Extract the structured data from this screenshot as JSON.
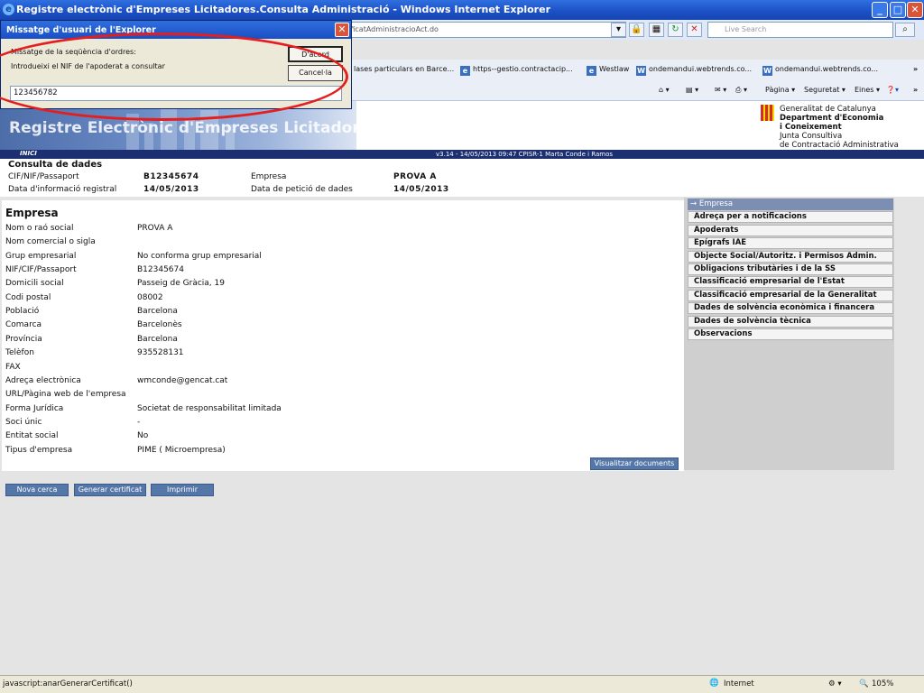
{
  "window": {
    "title": "Registre electrònic d'Empreses Licitadores.Consulta Administració - Windows Internet Explorer",
    "minimize": "_",
    "maximize": "□",
    "close": "✕"
  },
  "toolbar": {
    "address": "tificatAdministracioAct.do",
    "search_placeholder": "Live Search"
  },
  "favorites": [
    {
      "label": "lases particulars en Barce..."
    },
    {
      "label": "https--gestio.contractacip..."
    },
    {
      "label": "Westlaw"
    },
    {
      "label": "ondemandui.webtrends.co..."
    },
    {
      "label": "ondemandui.webtrends.co..."
    }
  ],
  "commands": {
    "page": "Pàgina ▾",
    "security": "Seguretat ▾",
    "tools": "Eines ▾",
    "more": "»"
  },
  "header": {
    "banner_title": "Registre Electrònic d'Empreses Licitadores",
    "org_line1": "Generalitat de Catalunya",
    "org_line2": "Department d'Economia",
    "org_line3": "i Coneixement",
    "org_line4": "Junta Consultiva",
    "org_line5": "de Contractació Administrativa"
  },
  "nav": {
    "home": "INICI",
    "version": "v3.14 - 14/05/2013 09:47 CPISR-1 Marta Conde i Ramos"
  },
  "summary": {
    "title": "Consulta de dades",
    "cif_label": "CIF/NIF/Passaport",
    "cif_value": "B12345674",
    "empresa_label": "Empresa",
    "empresa_value": "PROVA A",
    "data_info_label": "Data d'informació registral",
    "data_info_value": "14/05/2013",
    "data_pet_label": "Data de petició de dades",
    "data_pet_value": "14/05/2013"
  },
  "main": {
    "title": "Empresa",
    "rows": [
      {
        "label": "Nom o raó social",
        "value": "PROVA A"
      },
      {
        "label": "Nom comercial o sigla",
        "value": ""
      },
      {
        "label": "Grup empresarial",
        "value": "No conforma grup empresarial"
      },
      {
        "label": "NIF/CIF/Passaport",
        "value": "B12345674"
      },
      {
        "label": "Domicili social",
        "value": "Passeig de Gràcia, 19"
      },
      {
        "label": "Codi postal",
        "value": "08002"
      },
      {
        "label": "Població",
        "value": "Barcelona"
      },
      {
        "label": "Comarca",
        "value": "Barcelonès"
      },
      {
        "label": "Província",
        "value": "Barcelona"
      },
      {
        "label": "Telèfon",
        "value": "935528131"
      },
      {
        "label": "FAX",
        "value": ""
      },
      {
        "label": "Adreça electrònica",
        "value": "wmconde@gencat.cat"
      },
      {
        "label": "URL/Pàgina web de l'empresa",
        "value": ""
      },
      {
        "label": "Forma Jurídica",
        "value": "Societat de responsabilitat limitada"
      },
      {
        "label": "Soci únic",
        "value": "-"
      },
      {
        "label": "Entitat social",
        "value": "No"
      },
      {
        "label": "Tipus d'empresa",
        "value": "PIME ( Microempresa)"
      }
    ],
    "view_docs": "Visualitzar documents"
  },
  "actions": {
    "new_search": "Nova cerca",
    "generate": "Generar certificat",
    "print": "Imprimir"
  },
  "menu": [
    {
      "label": "→ Empresa"
    },
    {
      "label": "Adreça per a notificacions"
    },
    {
      "label": "Apoderats"
    },
    {
      "label": "Epígrafs IAE"
    },
    {
      "label": "Objecte Social/Autoritz. i Permisos Admin."
    },
    {
      "label": "Obligacions tributàries i de la SS"
    },
    {
      "label": "Classificació empresarial de l'Estat"
    },
    {
      "label": "Classificació empresarial de la Generalitat"
    },
    {
      "label": "Dades de solvència econòmica i financera"
    },
    {
      "label": "Dades de solvència tècnica"
    },
    {
      "label": "Observacions"
    }
  ],
  "dialog": {
    "title": "Missatge d'usuari de l'Explorer",
    "prompt_line1": "Missatge de la seqüència d'ordres:",
    "prompt_line2": "Introdueixi el NIF de l'apoderat a consultar",
    "ok": "D'acord",
    "cancel": "Cancel·la",
    "input_value": "123456782"
  },
  "status": {
    "url": "javascript:anarGenerarCertificat()",
    "zone": "Internet",
    "zoom": "105%"
  },
  "colors": {
    "highlight_ring": "#e41e1e",
    "nav_bar": "#1c2f70",
    "button_blue": "#5577a8"
  }
}
